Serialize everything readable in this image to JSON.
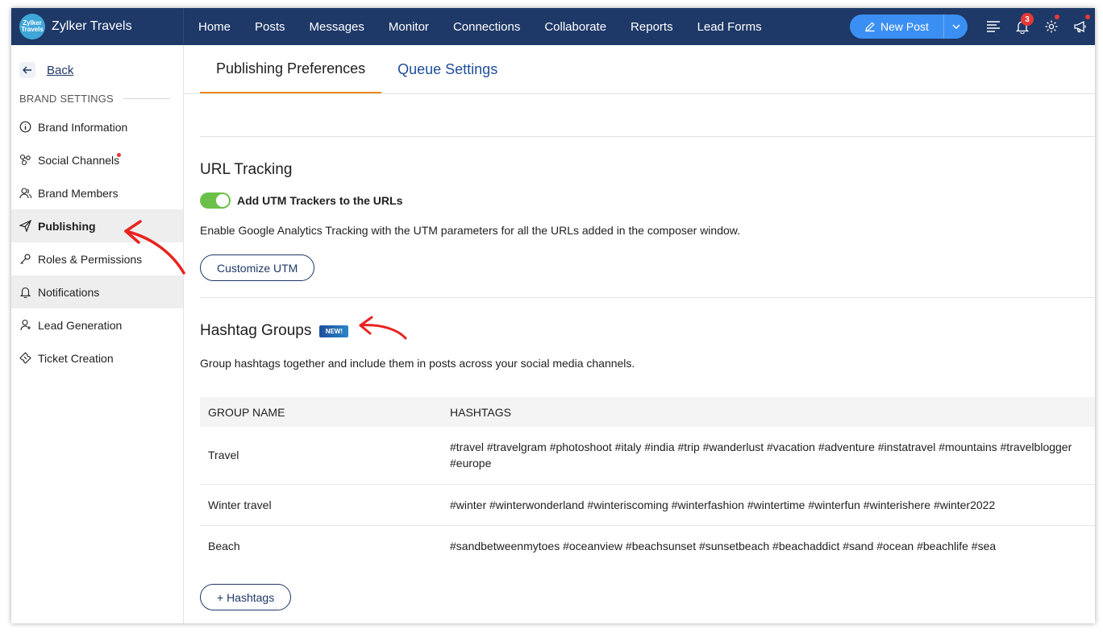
{
  "brand": {
    "name": "Zylker Travels",
    "logo_text": "Zylker Travels"
  },
  "nav": [
    {
      "label": "Home"
    },
    {
      "label": "Posts"
    },
    {
      "label": "Messages"
    },
    {
      "label": "Monitor"
    },
    {
      "label": "Connections"
    },
    {
      "label": "Collaborate"
    },
    {
      "label": "Reports"
    },
    {
      "label": "Lead Forms"
    }
  ],
  "toolbar": {
    "new_post_label": "New Post",
    "notification_count": "3"
  },
  "sidebar": {
    "back_label": "Back",
    "section_title": "BRAND SETTINGS",
    "items": [
      {
        "label": "Brand Information",
        "icon": "info-icon"
      },
      {
        "label": "Social Channels",
        "icon": "social-channels-icon"
      },
      {
        "label": "Brand Members",
        "icon": "members-icon"
      },
      {
        "label": "Publishing",
        "icon": "send-icon"
      },
      {
        "label": "Roles & Permissions",
        "icon": "key-icon"
      },
      {
        "label": "Notifications",
        "icon": "bell-icon"
      },
      {
        "label": "Lead Generation",
        "icon": "lead-icon"
      },
      {
        "label": "Ticket Creation",
        "icon": "ticket-icon"
      }
    ]
  },
  "tabs": [
    {
      "label": "Publishing Preferences",
      "active": true
    },
    {
      "label": "Queue Settings",
      "active": false
    }
  ],
  "url_tracking": {
    "title": "URL Tracking",
    "toggle_label": "Add UTM Trackers to the URLs",
    "toggle_on": true,
    "description": "Enable Google Analytics Tracking with the UTM parameters for all the URLs added in the composer window.",
    "button_label": "Customize UTM"
  },
  "hashtag_groups": {
    "title": "Hashtag Groups",
    "badge": "NEW!",
    "description": "Group hashtags together and include them in posts across your social media channels.",
    "columns": [
      "GROUP NAME",
      "HASHTAGS"
    ],
    "rows": [
      {
        "name": "Travel",
        "hashtags": "#travel #travelgram #photoshoot #italy #india #trip #wanderlust #vacation #adventure #instatravel #mountains #travelblogger #europe"
      },
      {
        "name": "Winter travel",
        "hashtags": "#winter #winterwonderland #winteriscoming #winterfashion #wintertime #winterfun #winterishere #winter2022"
      },
      {
        "name": "Beach",
        "hashtags": "#sandbetweenmytoes #oceanview #beachsunset #sunsetbeach #beachaddict #sand #ocean #beachlife #sea"
      }
    ],
    "add_button_label": "+ Hashtags"
  },
  "colors": {
    "topbar": "#1e3867",
    "accent": "#3b8ff2",
    "tab_underline": "#f08a24",
    "toggle_on": "#6cc04a",
    "annotation": "#e8231f"
  }
}
